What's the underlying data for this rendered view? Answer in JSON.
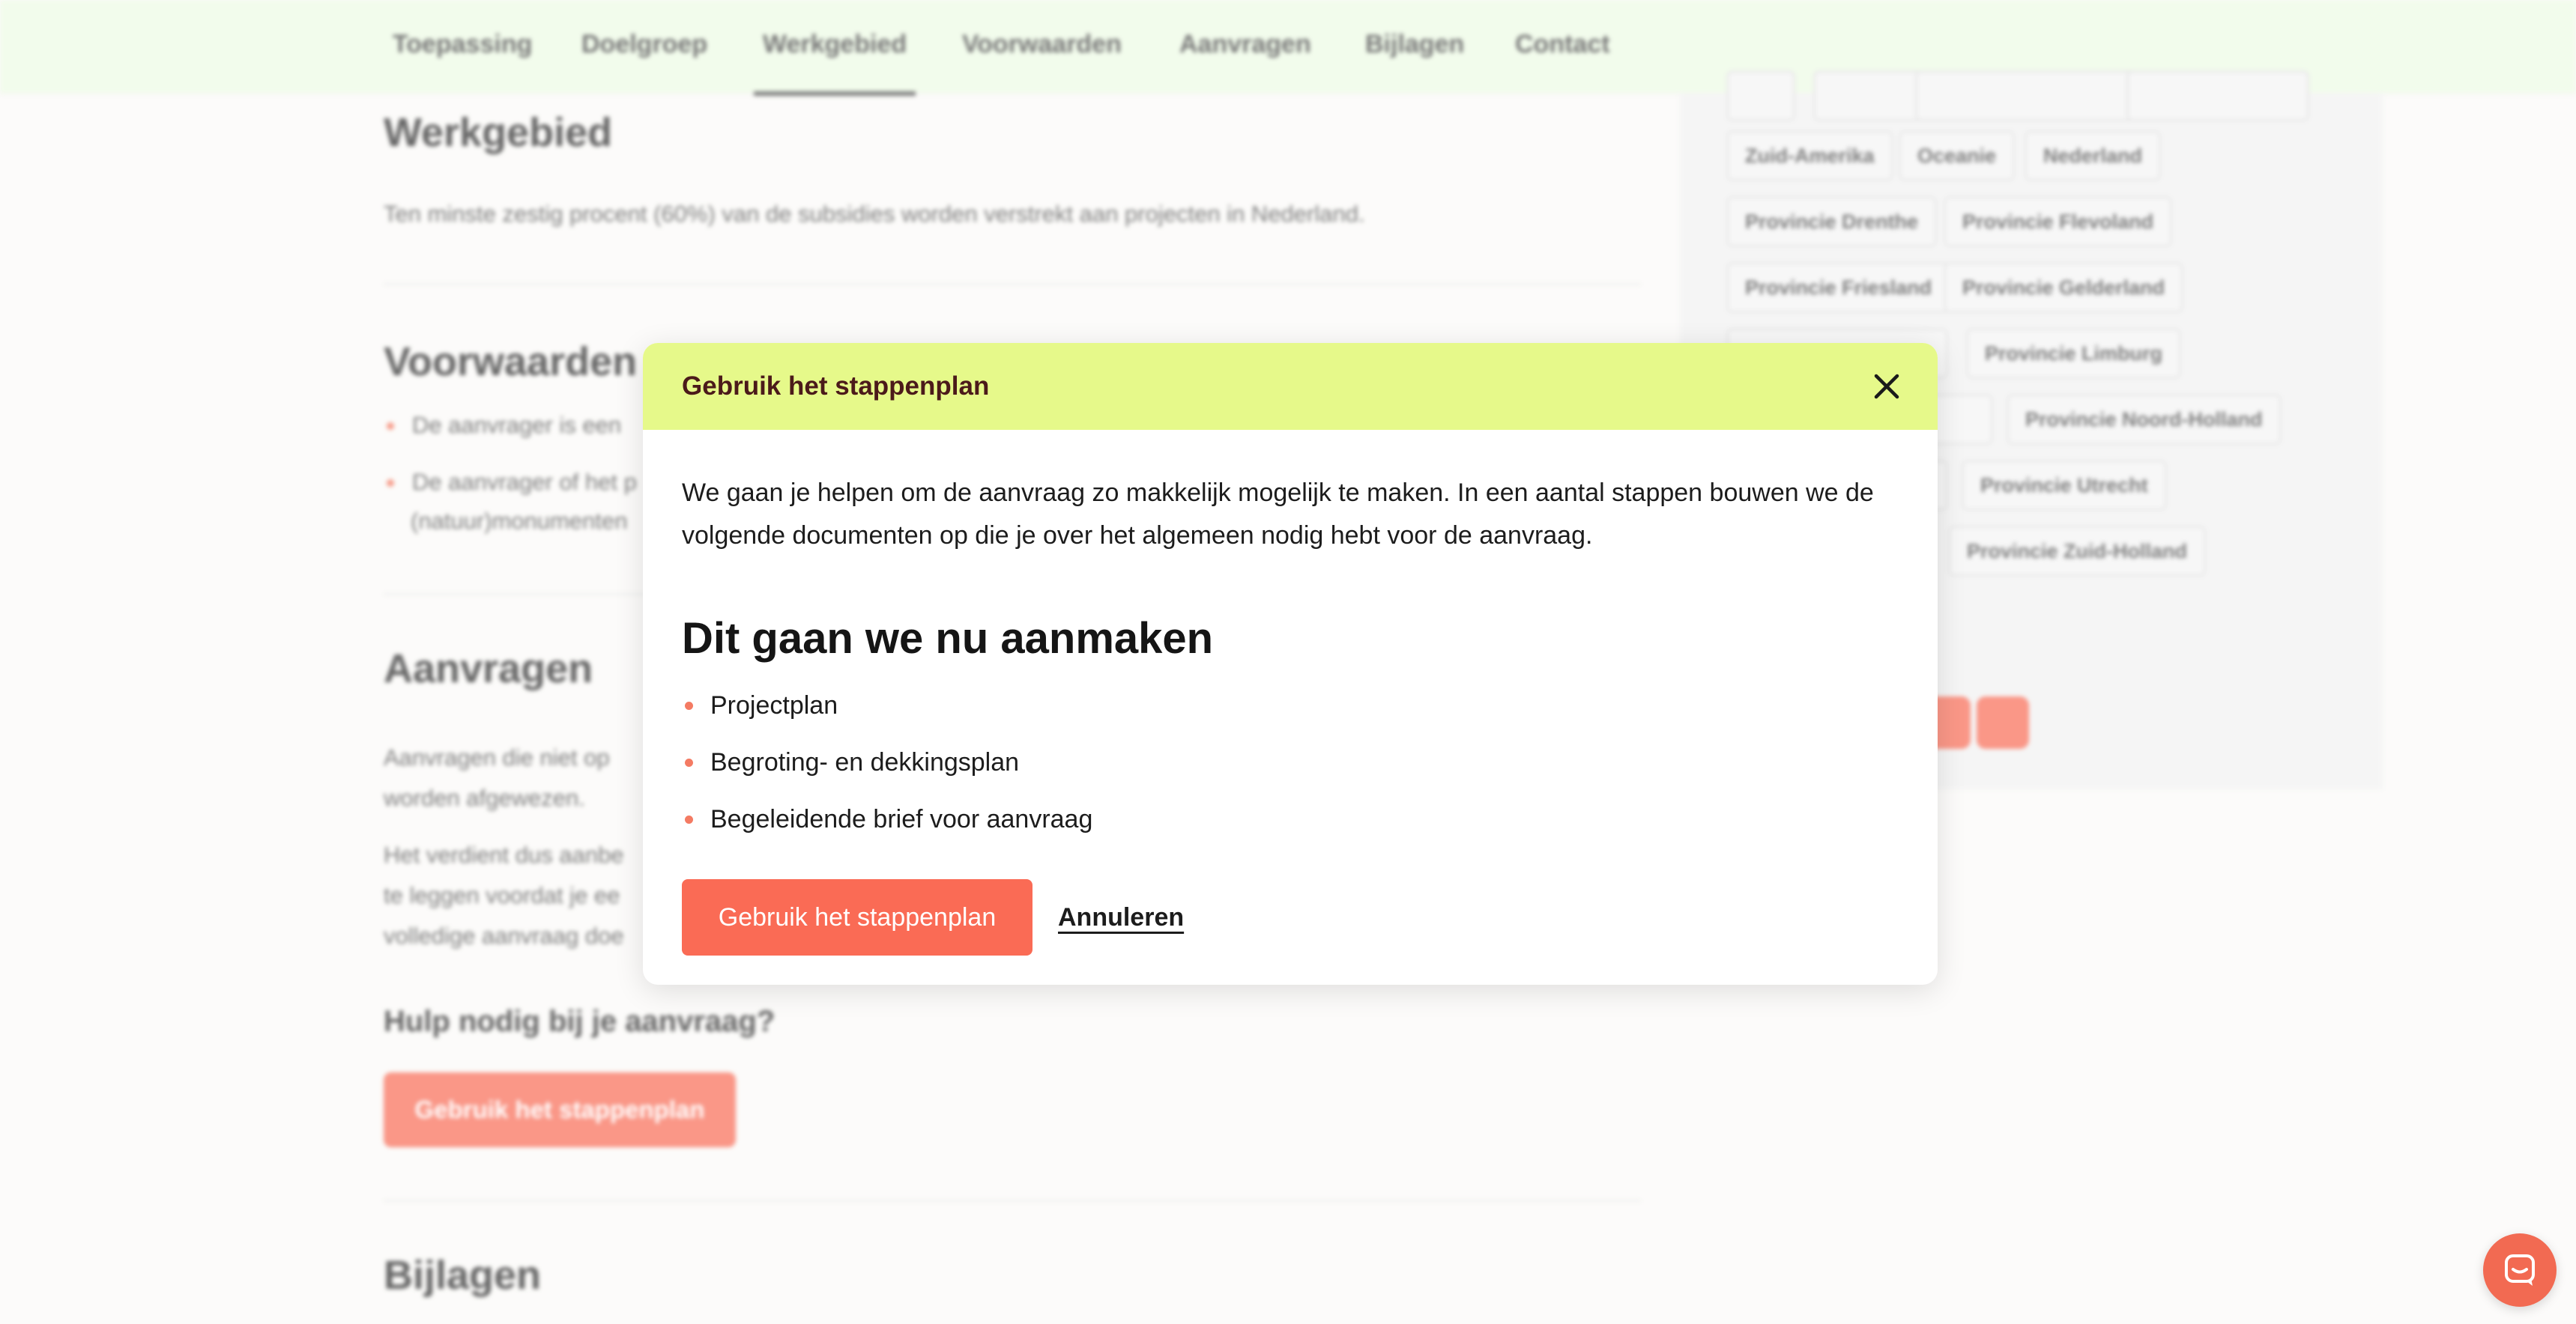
{
  "nav": {
    "items": [
      "Toepassing",
      "Doelgroep",
      "Werkgebied",
      "Voorwaarden",
      "Aanvragen",
      "Bijlagen",
      "Contact"
    ],
    "active": "Werkgebied"
  },
  "main": {
    "werkgebied_title": "Werkgebied",
    "werkgebied_text": "Ten minste zestig procent (60%) van de subsidies worden verstrekt aan projecten in Nederland.",
    "voorwaarden_title": "Voorwaarden",
    "voorwaarden_items": [
      "De aanvrager is een",
      "De aanvrager of het p",
      "(natuur)monumenten"
    ],
    "aanvragen_title": "Aanvragen",
    "aanvragen_lines": [
      "Aanvragen die niet op",
      "worden afgewezen.",
      "Het verdient dus aanbe",
      "te leggen voordat je ee",
      "volledige aanvraag doe"
    ],
    "help_title": "Hulp nodig bij je aanvraag?",
    "help_button": "Gebruik het stappenplan",
    "bijlagen_title": "Bijlagen"
  },
  "aside": {
    "tags": [
      "Zuid-Amerika",
      "Oceanie",
      "Nederland",
      "Provincie Drenthe",
      "Provincie Flevoland",
      "Provincie Friesland",
      "Provincie Gelderland",
      "Provincie Limburg",
      "Provincie Noord-Holland",
      "Provincie Utrecht",
      "Provincie Zuid-Holland"
    ]
  },
  "modal": {
    "title": "Gebruik het stappenplan",
    "intro": "We gaan je helpen om de aanvraag zo makkelijk mogelijk te maken. In een aantal stappen bouwen we de volgende documenten op die je over het algemeen nodig hebt voor de aanvraag.",
    "subtitle": "Dit gaan we nu aanmaken",
    "documents": [
      "Projectplan",
      "Begroting- en dekkingsplan",
      "Begeleidende brief voor aanvraag"
    ],
    "primary_button": "Gebruik het stappenplan",
    "cancel_label": "Annuleren"
  },
  "colors": {
    "header_bg": "#e6f98a",
    "primary": "#fa6b55",
    "bullet": "#f47b63",
    "nav_bg": "#eefbe6"
  },
  "icons": {
    "close": "close-icon",
    "chat": "chat-icon"
  }
}
